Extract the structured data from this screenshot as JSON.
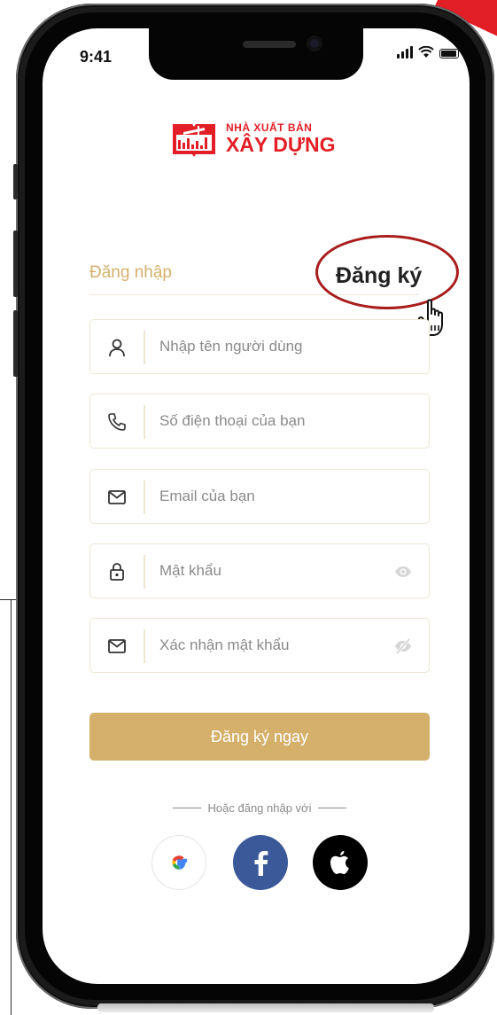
{
  "status_bar": {
    "time": "9:41"
  },
  "brand": {
    "line1": "NHÀ XUẤT BẢN",
    "line2": "XÂY DỰNG",
    "color": "#e21f26"
  },
  "tabs": {
    "login": "Đăng nhập",
    "signup": "Đăng ký",
    "active": "signup"
  },
  "fields": [
    {
      "icon": "user-icon",
      "placeholder": "Nhập tên người dùng"
    },
    {
      "icon": "phone-icon",
      "placeholder": "Số điện thoại của bạn"
    },
    {
      "icon": "mail-icon",
      "placeholder": "Email của bạn"
    },
    {
      "icon": "lock-icon",
      "placeholder": "Mật khẩu",
      "trailing_icon": "eye-icon"
    },
    {
      "icon": "mail-icon",
      "placeholder": "Xác nhận mật khẩu",
      "trailing_icon": "eye-off-icon"
    }
  ],
  "submit": {
    "label": "Đăng ký ngay"
  },
  "divider": {
    "text": "Hoặc đăng nhập với"
  },
  "social": [
    {
      "name": "google",
      "icon": "google-icon"
    },
    {
      "name": "facebook",
      "icon": "facebook-icon",
      "color": "#3b5998"
    },
    {
      "name": "apple",
      "icon": "apple-icon",
      "color": "#000000"
    }
  ],
  "colors": {
    "accent": "#d5b06a",
    "highlight": "#a91c1c"
  }
}
